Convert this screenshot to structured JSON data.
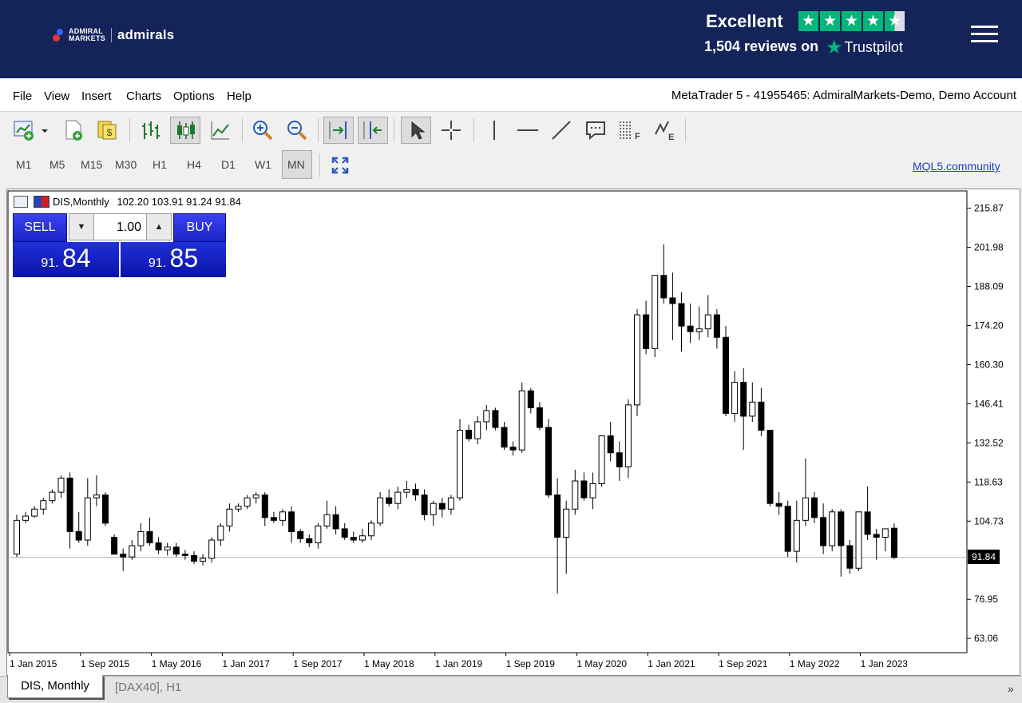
{
  "header": {
    "logo_line1": "ADMIRAL",
    "logo_line2": "MARKETS",
    "brand": "admirals",
    "trustpilot_rating": "Excellent",
    "trustpilot_reviews": "1,504 reviews on",
    "trustpilot_name": "Trustpilot",
    "star_glyph": "★",
    "colors": {
      "bar": "#14235a",
      "trustpilot_green": "#00b67a"
    }
  },
  "menu": {
    "items": [
      "File",
      "View",
      "Insert",
      "Charts",
      "Options",
      "Help"
    ],
    "account": "MetaTrader 5 - 41955465: AdmiralMarkets-Demo, Demo Account"
  },
  "toolbar": {
    "icons": [
      "new-chart-icon",
      "new-order-icon",
      "market-watch-icon",
      "bar-chart-icon",
      "candlestick-icon",
      "line-chart-icon",
      "zoom-in-icon",
      "zoom-out-icon",
      "chart-shift-icon",
      "auto-scroll-icon",
      "cursor-icon",
      "crosshair-icon",
      "vertical-line-icon",
      "horizontal-line-icon",
      "trend-line-icon",
      "text-label-icon",
      "fibonacci-icon",
      "elliott-wave-icon"
    ],
    "timeframes": [
      "M1",
      "M5",
      "M15",
      "M30",
      "H1",
      "H4",
      "D1",
      "W1",
      "MN"
    ],
    "active_timeframe": "MN",
    "fullscreen_icon": "fullscreen-icon",
    "community_link": "MQL5.community"
  },
  "chart": {
    "symbol_title": "DIS,Monthly",
    "ohlc_text": "102.20 103.91 91.24 91.84",
    "sell_label": "SELL",
    "buy_label": "BUY",
    "lot_value": "1.00",
    "down_arrow": "▼",
    "up_arrow": "▲",
    "sell_price_prefix": "91.",
    "sell_price_main": "84",
    "buy_price_prefix": "91.",
    "buy_price_main": "85",
    "last_price_label": "91.84",
    "colors": {
      "bull_fill": "#ffffff",
      "bear_fill": "#000000",
      "trade_blue": "#1a22c8"
    }
  },
  "chart_data": {
    "type": "candlestick",
    "title": "DIS,Monthly",
    "y_ticks": [
      "215.87",
      "201.98",
      "188.09",
      "174.20",
      "160.30",
      "146.41",
      "132.52",
      "118.63",
      "104.73",
      "91.84",
      "76.95",
      "63.06"
    ],
    "ylim": [
      58,
      222
    ],
    "x_labels": [
      "1 Jan 2015",
      "1 Sep 2015",
      "1 May 2016",
      "1 Jan 2017",
      "1 Sep 2017",
      "1 May 2018",
      "1 Jan 2019",
      "1 Sep 2019",
      "1 May 2020",
      "1 Jan 2021",
      "1 Sep 2021",
      "1 May 2022",
      "1 Jan 2023"
    ],
    "last_price": 91.84,
    "grid": false,
    "candles_ohlc": [
      [
        93.0,
        107.0,
        92.0,
        105.0
      ],
      [
        105.0,
        108.0,
        104.0,
        106.5
      ],
      [
        106.5,
        110.0,
        106.0,
        109.0
      ],
      [
        109.0,
        113.0,
        107.0,
        112.0
      ],
      [
        112.0,
        116.0,
        111.0,
        115.0
      ],
      [
        115.0,
        121.0,
        113.0,
        120.0
      ],
      [
        120.0,
        122.0,
        95.0,
        101.0
      ],
      [
        101.0,
        108.0,
        97.0,
        98.0
      ],
      [
        98.0,
        120.0,
        96.0,
        113.0
      ],
      [
        113.0,
        121.0,
        110.0,
        114.0
      ],
      [
        114.0,
        115.0,
        103.0,
        104.0
      ],
      [
        99.0,
        100.0,
        94.0,
        93.0
      ],
      [
        93.0,
        95.0,
        87.0,
        92.0
      ],
      [
        92.0,
        98.0,
        91.0,
        96.0
      ],
      [
        96.0,
        104.0,
        94.0,
        101.0
      ],
      [
        101.0,
        106.0,
        96.0,
        97.0
      ],
      [
        97.0,
        99.0,
        93.0,
        94.5
      ],
      [
        94.5,
        97.0,
        92.5,
        95.5
      ],
      [
        95.5,
        97.0,
        92.0,
        93.0
      ],
      [
        93.0,
        94.5,
        91.0,
        92.5
      ],
      [
        92.5,
        94.0,
        89.5,
        90.5
      ],
      [
        90.5,
        93.0,
        89.0,
        91.5
      ],
      [
        91.5,
        99.0,
        90.0,
        98.0
      ],
      [
        98.0,
        104.0,
        96.0,
        103.0
      ],
      [
        103.0,
        111.0,
        101.0,
        109.0
      ],
      [
        109.0,
        111.0,
        108.0,
        110.0
      ],
      [
        110.0,
        114.0,
        109.0,
        113.0
      ],
      [
        113.0,
        115.0,
        111.0,
        114.0
      ],
      [
        114.0,
        115.0,
        103.0,
        106.0
      ],
      [
        106.0,
        108.0,
        104.0,
        105.0
      ],
      [
        105.0,
        109.0,
        103.0,
        108.0
      ],
      [
        108.0,
        110.0,
        97.0,
        101.0
      ],
      [
        101.0,
        102.0,
        97.0,
        98.5
      ],
      [
        98.5,
        100.0,
        95.5,
        97.0
      ],
      [
        97.0,
        104.0,
        95.0,
        103.0
      ],
      [
        103.0,
        112.0,
        102.0,
        107.0
      ],
      [
        107.0,
        110.0,
        100.0,
        102.0
      ],
      [
        102.0,
        104.0,
        98.0,
        99.0
      ],
      [
        99.0,
        101.0,
        97.0,
        98.0
      ],
      [
        98.0,
        102.0,
        97.0,
        99.5
      ],
      [
        99.5,
        105.0,
        98.0,
        104.0
      ],
      [
        104.0,
        115.0,
        103.0,
        113.0
      ],
      [
        113.0,
        116.0,
        110.0,
        111.0
      ],
      [
        111.0,
        117.0,
        109.0,
        115.0
      ],
      [
        115.0,
        119.0,
        113.0,
        116.0
      ],
      [
        116.0,
        118.0,
        112.0,
        114.0
      ],
      [
        114.0,
        116.0,
        105.0,
        107.0
      ],
      [
        107.0,
        112.0,
        103.0,
        111.0
      ],
      [
        111.0,
        113.0,
        106.0,
        109.0
      ],
      [
        109.0,
        114.0,
        107.0,
        113.0
      ],
      [
        113.0,
        141.0,
        112.0,
        137.0
      ],
      [
        137.0,
        139.0,
        133.0,
        134.0
      ],
      [
        134.0,
        142.0,
        132.0,
        140.0
      ],
      [
        140.0,
        146.0,
        137.0,
        144.0
      ],
      [
        144.0,
        145.0,
        137.0,
        138.0
      ],
      [
        138.0,
        140.0,
        130.0,
        131.0
      ],
      [
        131.0,
        133.0,
        128.0,
        130.0
      ],
      [
        130.0,
        154.0,
        129.0,
        151.0
      ],
      [
        151.0,
        152.0,
        143.0,
        145.0
      ],
      [
        145.0,
        147.0,
        137.0,
        138.0
      ],
      [
        138.0,
        141.0,
        113.0,
        114.0
      ],
      [
        114.0,
        120.0,
        79.0,
        99.0
      ],
      [
        99.0,
        112.0,
        86.0,
        109.0
      ],
      [
        109.0,
        123.0,
        107.0,
        119.0
      ],
      [
        119.0,
        122.0,
        112.0,
        113.0
      ],
      [
        113.0,
        122.0,
        109.0,
        118.0
      ],
      [
        118.0,
        133.0,
        117.0,
        135.0
      ],
      [
        135.0,
        140.0,
        126.0,
        129.0
      ],
      [
        129.0,
        133.0,
        119.0,
        124.0
      ],
      [
        124.0,
        148.0,
        120.0,
        146.0
      ],
      [
        146.0,
        180.0,
        142.0,
        178.0
      ],
      [
        178.0,
        183.0,
        164.0,
        166.0
      ],
      [
        166.0,
        190.0,
        163.0,
        192.0
      ],
      [
        192.0,
        203.0,
        182.0,
        184.0
      ],
      [
        184.0,
        193.0,
        169.0,
        182.0
      ],
      [
        182.0,
        186.0,
        165.0,
        174.0
      ],
      [
        174.0,
        182.0,
        168.0,
        172.0
      ],
      [
        172.0,
        181.0,
        169.0,
        173.0
      ],
      [
        173.0,
        185.0,
        170.0,
        178.0
      ],
      [
        178.0,
        180.0,
        166.0,
        170.0
      ],
      [
        170.0,
        174.0,
        142.0,
        143.0
      ],
      [
        143.0,
        158.0,
        140.0,
        154.0
      ],
      [
        154.0,
        159.0,
        130.0,
        142.0
      ],
      [
        142.0,
        154.0,
        140.0,
        147.0
      ],
      [
        147.0,
        152.0,
        135.0,
        137.0
      ],
      [
        137.0,
        136.0,
        110.0,
        111.0
      ],
      [
        111.0,
        115.0,
        107.0,
        110.0
      ],
      [
        110.0,
        112.0,
        92.0,
        94.0
      ],
      [
        94.0,
        112.0,
        90.0,
        105.0
      ],
      [
        105.0,
        127.0,
        103.0,
        113.0
      ],
      [
        113.0,
        115.0,
        104.0,
        106.0
      ],
      [
        106.0,
        111.0,
        93.0,
        96.0
      ],
      [
        96.0,
        109.0,
        94.0,
        108.0
      ],
      [
        108.0,
        109.0,
        85.0,
        96.0
      ],
      [
        96.0,
        98.0,
        86.0,
        88.0
      ],
      [
        88.0,
        98.0,
        87.0,
        108.0
      ],
      [
        108.0,
        117.0,
        98.0,
        100.0
      ],
      [
        100.0,
        102.0,
        91.0,
        99.0
      ],
      [
        99.0,
        101.0,
        94.0,
        102.0
      ],
      [
        102.2,
        103.91,
        91.24,
        91.84
      ]
    ]
  },
  "tabs": {
    "items": [
      "DIS, Monthly",
      "[DAX40], H1"
    ],
    "active": "DIS, Monthly",
    "more_glyph": "»"
  }
}
